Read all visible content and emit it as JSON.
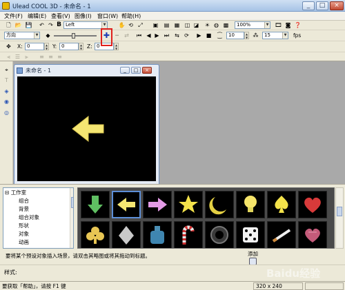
{
  "window": {
    "title": "Ulead COOL 3D - 未命名 - 1",
    "controls": [
      "_",
      "□",
      "×"
    ]
  },
  "menu": [
    "文件(F)",
    "编辑(E)",
    "查看(V)",
    "图像(I)",
    "窗口(W)",
    "帮助(H)"
  ],
  "toolbar": {
    "text_align_value": "Left",
    "zoom_value": "100%",
    "mode_value": "方向",
    "frames_value": "10",
    "fps_value": "15",
    "fps_label": "fps",
    "x_label": "X:",
    "x_value": "0",
    "y_label": "Y:",
    "y_value": "0",
    "z_label": "Z:",
    "z_value": "0"
  },
  "document": {
    "title": "未命名 - 1"
  },
  "tree": {
    "items": [
      "工作室",
      "组合",
      "背景",
      "组合对象",
      "形状",
      "对象",
      "动画"
    ]
  },
  "gallery": {
    "items": [
      "down-arrow",
      "left-arrow",
      "right-arrow",
      "star",
      "crescent",
      "light-bulb",
      "spade",
      "heart",
      "club",
      "diamond",
      "bottle",
      "candy-cane",
      "tire",
      "dice",
      "cigarette",
      "heart-box"
    ],
    "selected_index": 1
  },
  "hint": "要将某个预设对象插入场景，请双击其略图或将其拖动到标题。",
  "add_label": "添加",
  "style_label": "样式:",
  "status": {
    "text": "要获取「帮助」，请按 F1 键",
    "size": "320 x 240"
  },
  "watermark": "Baidu经验",
  "colors": {
    "title_bar": "#a6c3e6",
    "canvas": "#000000",
    "arrow": "#f5e672",
    "highlight": "#e0201c",
    "selected_thumb": "#5d8fd8"
  }
}
